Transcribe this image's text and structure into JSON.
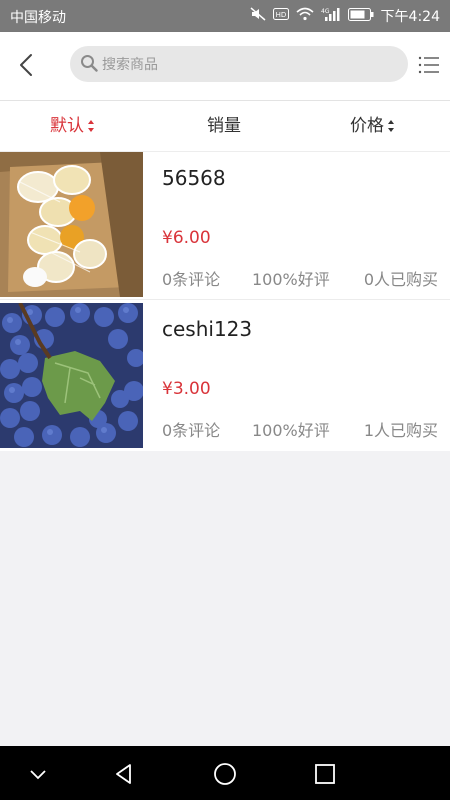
{
  "status_bar": {
    "carrier": "中国移动",
    "time": "下午4:24"
  },
  "header": {
    "search": {
      "placeholder": "搜索商品",
      "value": ""
    }
  },
  "sort_options": {
    "default": "默认",
    "sales": "销量",
    "price": "价格",
    "active": "default"
  },
  "products": [
    {
      "name": "56568",
      "price": "¥6.00",
      "reviews": "0条评论",
      "rating": "100%好评",
      "buyers": "0人已购买",
      "image": "oranges-in-box"
    },
    {
      "name": "ceshi123",
      "price": "¥3.00",
      "reviews": "0条评论",
      "rating": "100%好评",
      "buyers": "1人已购买",
      "image": "grape-bunch"
    }
  ],
  "colors": {
    "accent": "#d9343a",
    "status_bar": "#7a7a7a",
    "background": "#f2f2f4"
  }
}
